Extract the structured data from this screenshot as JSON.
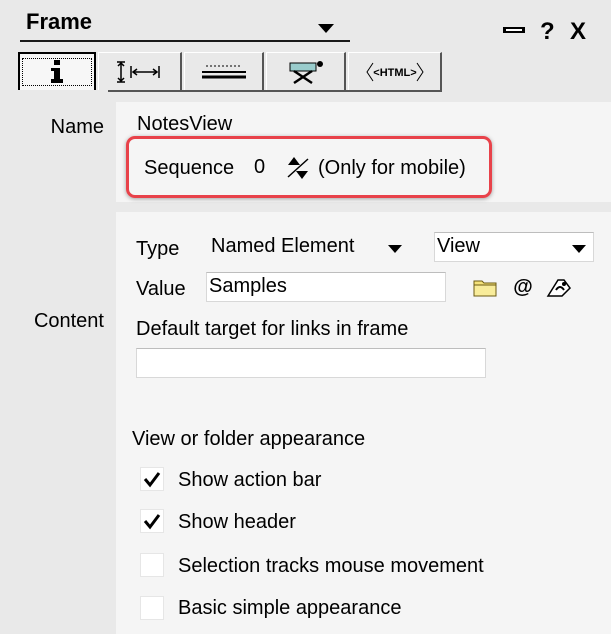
{
  "header": {
    "title": "Frame",
    "minimize_glyph": "▬",
    "help_glyph": "?",
    "close_glyph": "X"
  },
  "tabs": [
    {
      "name": "info-tab",
      "icon": "info-icon",
      "glyph": "i"
    },
    {
      "name": "size-tab",
      "icon": "size-arrows-icon",
      "glyph": "↨|↔|"
    },
    {
      "name": "borders-tab",
      "icon": "borders-icon",
      "glyph": ""
    },
    {
      "name": "advanced-tab",
      "icon": "advanced-icon",
      "glyph": "✕"
    },
    {
      "name": "html-tab",
      "icon": "html-icon",
      "glyph": "<HTML>"
    }
  ],
  "name_section": {
    "label": "Name",
    "name_value": "NotesView",
    "sequence_label": "Sequence",
    "sequence_value": "0",
    "sequence_note": "(Only for mobile)"
  },
  "content_section": {
    "label": "Content",
    "type_label": "Type",
    "type_value": "Named Element",
    "type_kind_value": "View",
    "value_label": "Value",
    "value_value": "Samples",
    "default_target_label": "Default target for links in frame",
    "default_target_value": "",
    "appearance_label": "View or folder appearance",
    "options": [
      {
        "label": "Show action bar",
        "checked": true
      },
      {
        "label": "Show header",
        "checked": true
      },
      {
        "label": "Selection tracks mouse movement",
        "checked": false
      },
      {
        "label": "Basic simple appearance",
        "checked": false
      }
    ],
    "at_glyph": "@"
  },
  "colors": {
    "highlight": "#e8424a",
    "panel": "#e9e9e9",
    "section": "#f5f5f5"
  }
}
